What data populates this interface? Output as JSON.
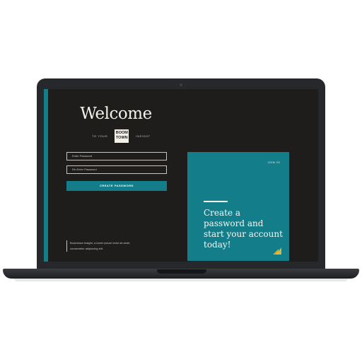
{
  "welcome": {
    "title": "Welcome",
    "to_your": "TO YOUR",
    "logo_line1": "BOOM",
    "logo_line2": "TOWN",
    "insight": "INSIGHT"
  },
  "form": {
    "password_placeholder": "Enter Password",
    "reenter_placeholder": "Re-Enter Password",
    "submit_label": "CREATE PASSWORD"
  },
  "footer": {
    "text": "Boomtown Insight, a lorem ipsum dolor sit amet, consectetur adipiscing elit."
  },
  "card": {
    "date": "JOIN 23",
    "heading": "Create a password and start your account today!"
  },
  "colors": {
    "accent": "#137e8a",
    "background": "#1f1c1c",
    "text_light": "#f3f0ea",
    "bezel": "#27282b"
  },
  "icons": [
    "camera-icon",
    "brand-mark-icon"
  ]
}
